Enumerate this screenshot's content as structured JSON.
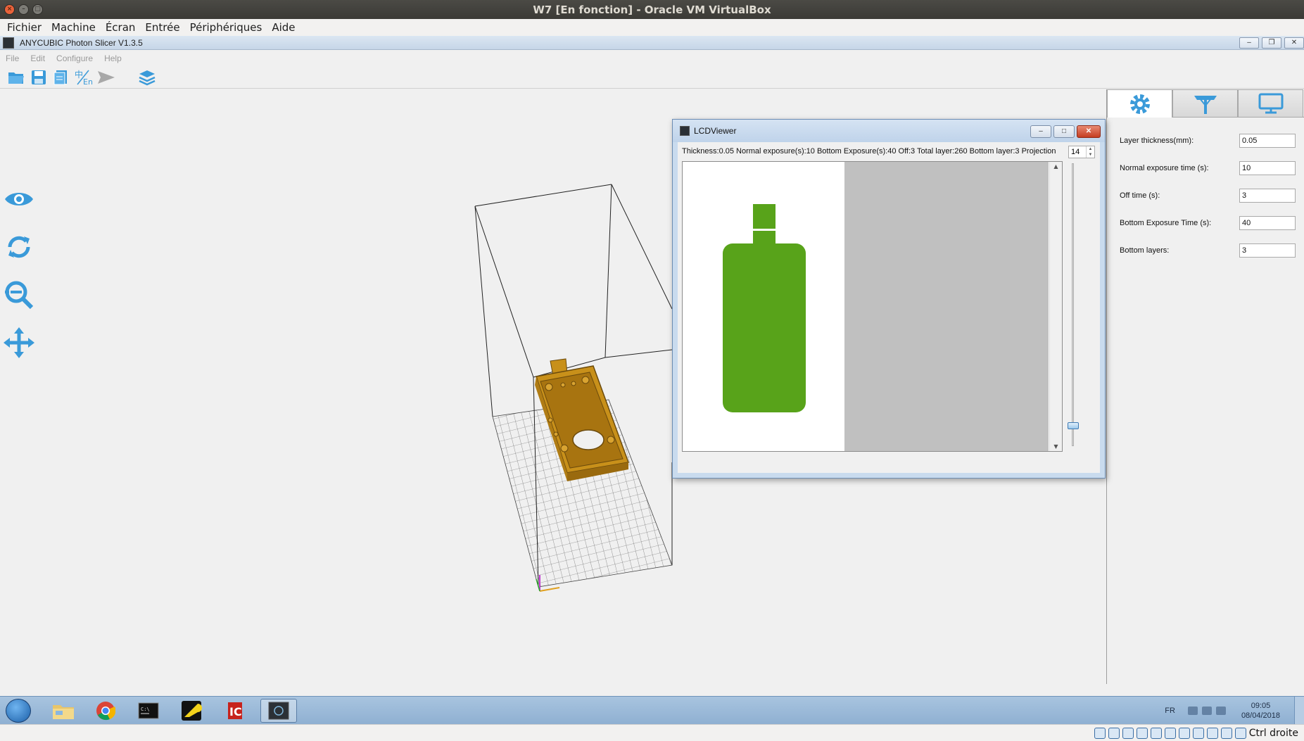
{
  "host": {
    "title": "W7 [En fonction] - Oracle VM VirtualBox",
    "menu": [
      "Fichier",
      "Machine",
      "Écran",
      "Entrée",
      "Périphériques",
      "Aide"
    ],
    "status_text": "Ctrl droite"
  },
  "app": {
    "title": "ANYCUBIC Photon Slicer V1.3.5",
    "menu": [
      "File",
      "Edit",
      "Configure",
      "Help"
    ],
    "accent_color": "#3a9ad9"
  },
  "settings": {
    "fields": [
      {
        "label": "Layer thickness(mm):",
        "value": "0.05"
      },
      {
        "label": "Normal exposure time (s):",
        "value": "10"
      },
      {
        "label": "Off time (s):",
        "value": "3"
      },
      {
        "label": "Bottom Exposure Time (s):",
        "value": "40"
      },
      {
        "label": "Bottom layers:",
        "value": "3"
      }
    ]
  },
  "lcd_viewer": {
    "title": "LCDViewer",
    "info": "Thickness:0.05  Normal exposure(s):10  Bottom Exposure(s):40  Off:3  Total layer:260  Bottom layer:3  Projection",
    "layer_value": "14",
    "slice_color": "#58a31a",
    "slider_level_fraction": 0.06
  },
  "model": {
    "color": "#c8901a"
  },
  "taskbar": {
    "apps": [
      "explorer",
      "chrome",
      "cmd",
      "app-yellow",
      "app-red",
      "photon-slicer"
    ],
    "lang": "FR",
    "time": "09:05",
    "date": "08/04/2018"
  }
}
